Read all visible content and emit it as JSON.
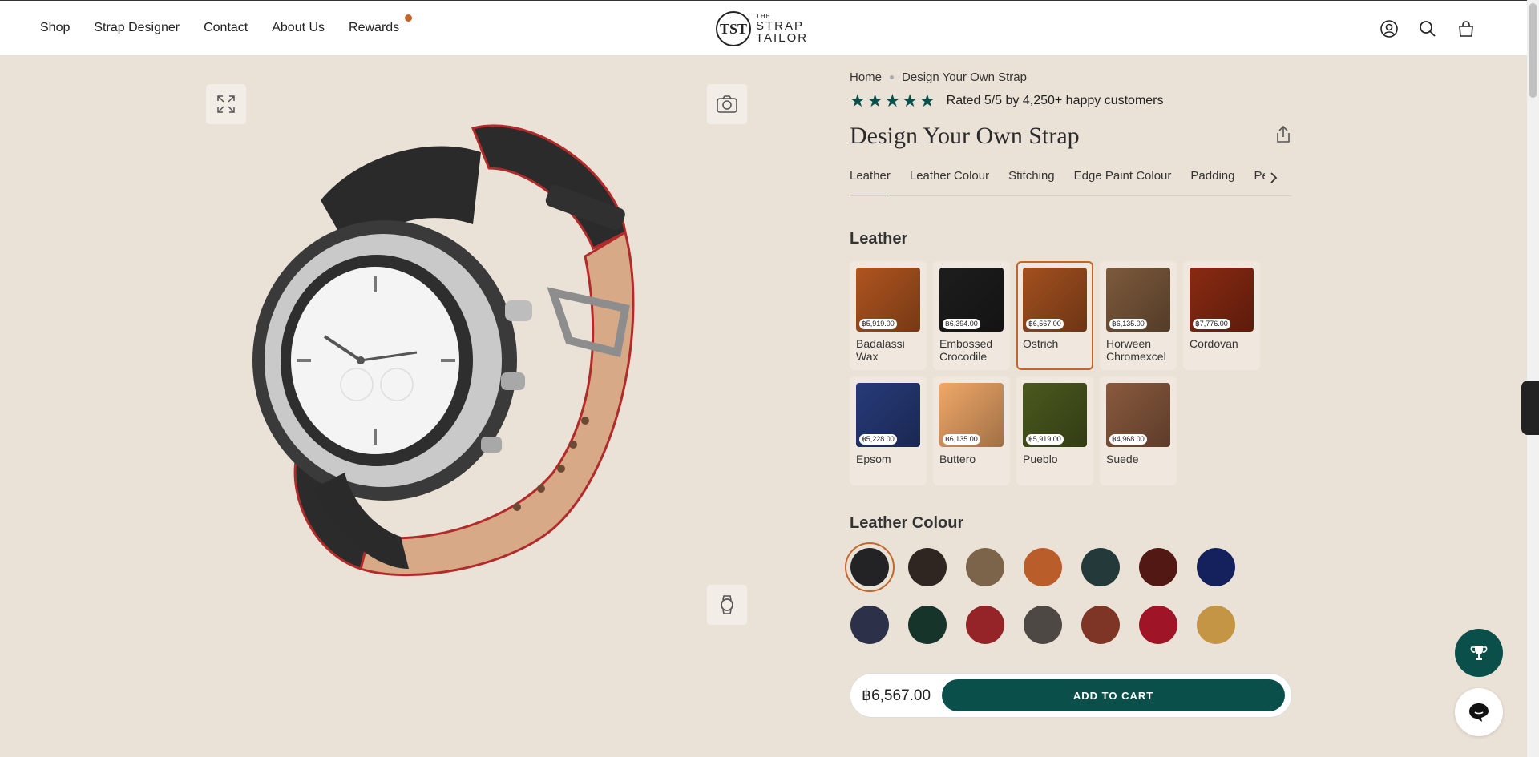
{
  "nav": {
    "items": [
      "Shop",
      "Strap Designer",
      "Contact",
      "About Us",
      "Rewards"
    ]
  },
  "logo": {
    "the": "THE",
    "line1": "STRAP",
    "line2": "TAILOR"
  },
  "breadcrumb": {
    "home": "Home",
    "current": "Design Your Own Strap"
  },
  "rating": {
    "stars": 5,
    "text": "Rated 5/5 by 4,250+ happy customers"
  },
  "product": {
    "title": "Design Your Own Strap"
  },
  "tabs": [
    "Leather",
    "Leather Colour",
    "Stitching",
    "Edge Paint Colour",
    "Padding",
    "Pe"
  ],
  "leather_section": {
    "title": "Leather"
  },
  "leathers": [
    {
      "name": "Badalassi Wax",
      "price": "฿5,919.00",
      "color": "#b0551f",
      "selected": false
    },
    {
      "name": "Embossed Crocodile",
      "price": "฿6,394.00",
      "color": "#1d1d1d",
      "selected": false
    },
    {
      "name": "Ostrich",
      "price": "฿6,567.00",
      "color": "#a3501f",
      "selected": true
    },
    {
      "name": "Horween Chromexcel",
      "price": "฿6,135.00",
      "color": "#7d5a3c",
      "selected": false
    },
    {
      "name": "Cordovan",
      "price": "฿7,776.00",
      "color": "#8a2a12",
      "selected": false
    },
    {
      "name": "Epsom",
      "price": "฿5,228.00",
      "color": "#273b7a",
      "selected": false
    },
    {
      "name": "Buttero",
      "price": "฿6,135.00",
      "color": "#f0a868",
      "selected": false
    },
    {
      "name": "Pueblo",
      "price": "฿5,919.00",
      "color": "#4b5a1e",
      "selected": false
    },
    {
      "name": "Suede",
      "price": "฿4,968.00",
      "color": "#8a5a3e",
      "selected": false
    }
  ],
  "colour_section": {
    "title": "Leather Colour"
  },
  "colours": [
    {
      "hex": "#232325",
      "selected": true
    },
    {
      "hex": "#2f2622",
      "selected": false
    },
    {
      "hex": "#7b6449",
      "selected": false
    },
    {
      "hex": "#b95e2b",
      "selected": false
    },
    {
      "hex": "#23393a",
      "selected": false
    },
    {
      "hex": "#521814",
      "selected": false
    },
    {
      "hex": "#15215c",
      "selected": false
    },
    {
      "hex": "#2c3048",
      "selected": false
    },
    {
      "hex": "#17342b",
      "selected": false
    },
    {
      "hex": "#942427",
      "selected": false
    },
    {
      "hex": "#4d4843",
      "selected": false
    },
    {
      "hex": "#7e3526",
      "selected": false
    },
    {
      "hex": "#a01428",
      "selected": false
    },
    {
      "hex": "#c49545",
      "selected": false
    }
  ],
  "cart": {
    "price": "฿6,567.00",
    "button": "ADD TO CART"
  },
  "colors": {
    "accent": "#c4662a",
    "brand": "#0b4f4a",
    "background": "#ebe2d7"
  }
}
